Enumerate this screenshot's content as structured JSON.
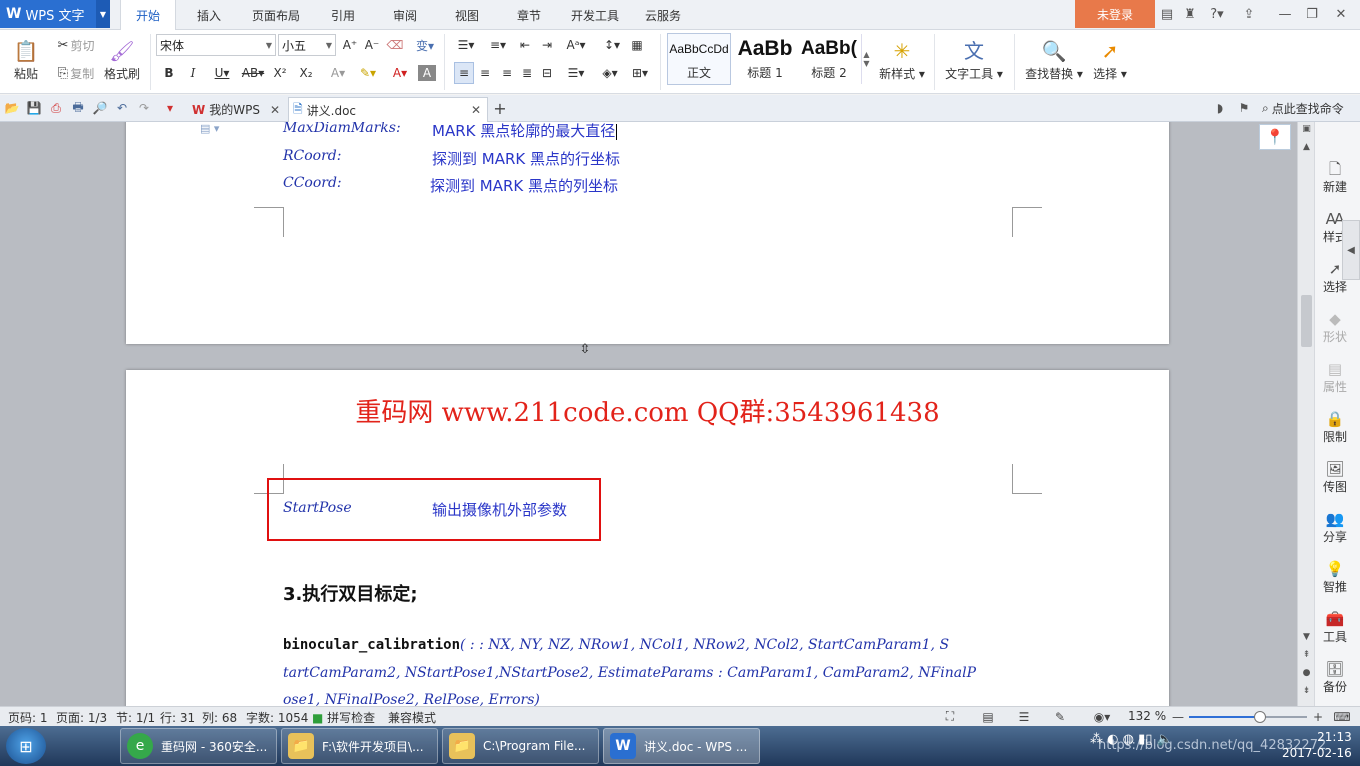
{
  "app": {
    "name": "WPS 文字",
    "login": "未登录"
  },
  "menu": {
    "tabs": [
      "开始",
      "插入",
      "页面布局",
      "引用",
      "审阅",
      "视图",
      "章节",
      "开发工具",
      "云服务"
    ]
  },
  "ribbon": {
    "paste": "粘贴",
    "cut": "剪切",
    "copy": "复制",
    "format_painter": "格式刷",
    "font_name": "宋体",
    "font_size": "小五",
    "styles": [
      {
        "sample": "AaBbCcDd",
        "name": "正文"
      },
      {
        "sample": "AaBb",
        "name": "标题 1"
      },
      {
        "sample": "AaBb(",
        "name": "标题 2"
      }
    ],
    "new_style": "新样式",
    "text_tools": "文字工具",
    "find_replace": "查找替换",
    "select": "选择"
  },
  "tabs": {
    "home_tab": "我的WPS",
    "doc_tab": "讲义.doc",
    "search_cmd": "点此查找命令"
  },
  "document": {
    "page1_params": [
      {
        "name": "MaxDiamMarks:",
        "desc": "MARK 黑点轮廓的最大直径"
      },
      {
        "name": "RCoord:",
        "desc": "探测到 MARK 黑点的行坐标"
      },
      {
        "name": "CCoord:",
        "desc": "探测到 MARK 黑点的列坐标"
      }
    ],
    "banner": "重码网 www.211code.com  QQ群:3543961438",
    "startpose_name": "StartPose",
    "startpose_desc": "输出摄像机外部参数",
    "heading": "3.执行双目标定;",
    "code_fn": "binocular_calibration",
    "code_line1_rest": "( : :  NX,  NY,  NZ,  NRow1,  NCol1,  NRow2,  NCol2,  StartCamParam1,  S",
    "code_line2": "tartCamParam2,  NStartPose1,NStartPose2,  EstimateParams  :  CamParam1,  CamParam2,  NFinalP",
    "code_line3": "ose1,  NFinalPose2,  RelPose,  Errors)"
  },
  "sidepanel": [
    "新建",
    "样式",
    "选择",
    "形状",
    "属性",
    "限制",
    "传图",
    "分享",
    "智推",
    "工具",
    "备份"
  ],
  "status": {
    "page_code": "页码: 1",
    "page": "页面: 1/3",
    "section": "节: 1/1",
    "line": "行: 31",
    "column": "列: 68",
    "word_count": "字数: 1054",
    "spell_check": "拼写检查",
    "compat_mode": "兼容模式",
    "zoom": "132 %",
    "zoom_fraction": 0.6
  },
  "taskbar": {
    "items": [
      {
        "label": "重码网 - 360安全..."
      },
      {
        "label": "F:\\软件开发项目\\..."
      },
      {
        "label": "C:\\Program File..."
      },
      {
        "label": "讲义.doc - WPS ..."
      }
    ],
    "clock_time": "21:13",
    "clock_date": "2017-02-16",
    "watermark": "https://blog.csdn.net/qq_42832272"
  }
}
